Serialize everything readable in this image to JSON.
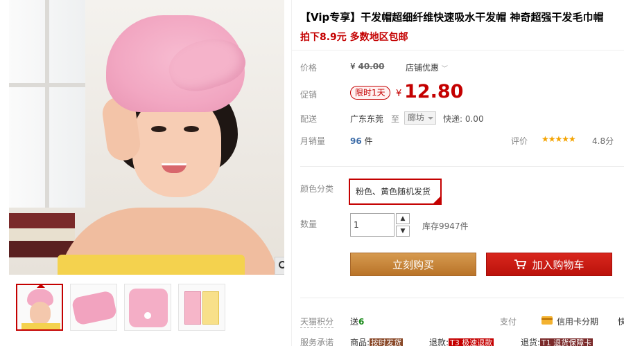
{
  "product": {
    "title": "【Vip专享】干发帽超细纤维快速吸水干发帽 神奇超强干发毛巾帽",
    "promo": "拍下8.9元 多数地区包邮"
  },
  "price": {
    "label": "价格",
    "currency": "¥",
    "original": "40.00",
    "store_discount": "店铺优惠"
  },
  "promo_price": {
    "label": "促销",
    "tag": "限时1天",
    "currency": "¥",
    "value": "12.80"
  },
  "shipping": {
    "label": "配送",
    "from": "广东东莞",
    "to_word": "至",
    "destination": "廊坊",
    "fee": "快递: 0.00"
  },
  "sales": {
    "label": "月销量",
    "count": "96",
    "unit": "件",
    "rating_label": "评价",
    "stars": "★★★★★",
    "score": "4.8分"
  },
  "options": {
    "color_label": "颜色分类",
    "color_selected": "粉色、黄色随机发货",
    "qty_label": "数量",
    "qty_value": "1",
    "qty_up": "▲",
    "qty_down": "▼",
    "stock": "库存9947件"
  },
  "actions": {
    "buy_now": "立刻购买",
    "add_to_cart": "加入购物车"
  },
  "extras": {
    "points_label": "天猫积分",
    "points_prefix": "送",
    "points_value": "6",
    "pay_label": "支付",
    "pay_method": "信用卡分期",
    "pay_more": "快",
    "service_label": "服务承诺",
    "service_goods": "商品:",
    "service_goods_badge": "按时发货",
    "service_refund": "退款:",
    "service_refund_badge": "T3 极速退款",
    "service_return": "退货:",
    "service_return_badge": "T1 退货保障卡"
  },
  "icons": {
    "zoom": "magnifier-icon",
    "cart": "cart-icon",
    "card": "credit-card-icon"
  },
  "colors": {
    "accent_red": "#c40000",
    "buy_btn": "#c47d33",
    "cart_btn": "#c8190f",
    "star": "#f4a300"
  }
}
